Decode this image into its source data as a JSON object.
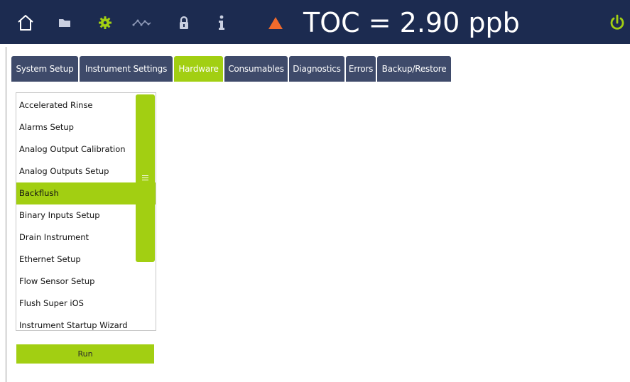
{
  "header": {
    "status_text": "TOC = 2.90 ppb",
    "icons": [
      "home-icon",
      "folder-icon",
      "gear-icon",
      "trend-icon",
      "lock-icon",
      "info-icon",
      "warning-icon",
      "power-icon"
    ],
    "colors": {
      "bar": "#1c2b50",
      "accent": "#a2cf12",
      "warning": "#ef6a2c",
      "tab": "#3e4a6a"
    }
  },
  "tabs": [
    {
      "label": "System Setup"
    },
    {
      "label": "Instrument Settings"
    },
    {
      "label": "Hardware",
      "active": true
    },
    {
      "label": "Consumables"
    },
    {
      "label": "Diagnostics"
    },
    {
      "label": "Errors"
    },
    {
      "label": "Backup/Restore"
    }
  ],
  "list": {
    "items": [
      "Accelerated Rinse",
      "Alarms Setup",
      "Analog Output Calibration",
      "Analog Outputs Setup",
      "Backflush",
      "Binary Inputs Setup",
      "Drain Instrument",
      "Ethernet Setup",
      "Flow Sensor Setup",
      "Flush Super iOS",
      "Instrument Startup Wizard"
    ],
    "selected": "Backflush"
  },
  "run_label": "Run"
}
